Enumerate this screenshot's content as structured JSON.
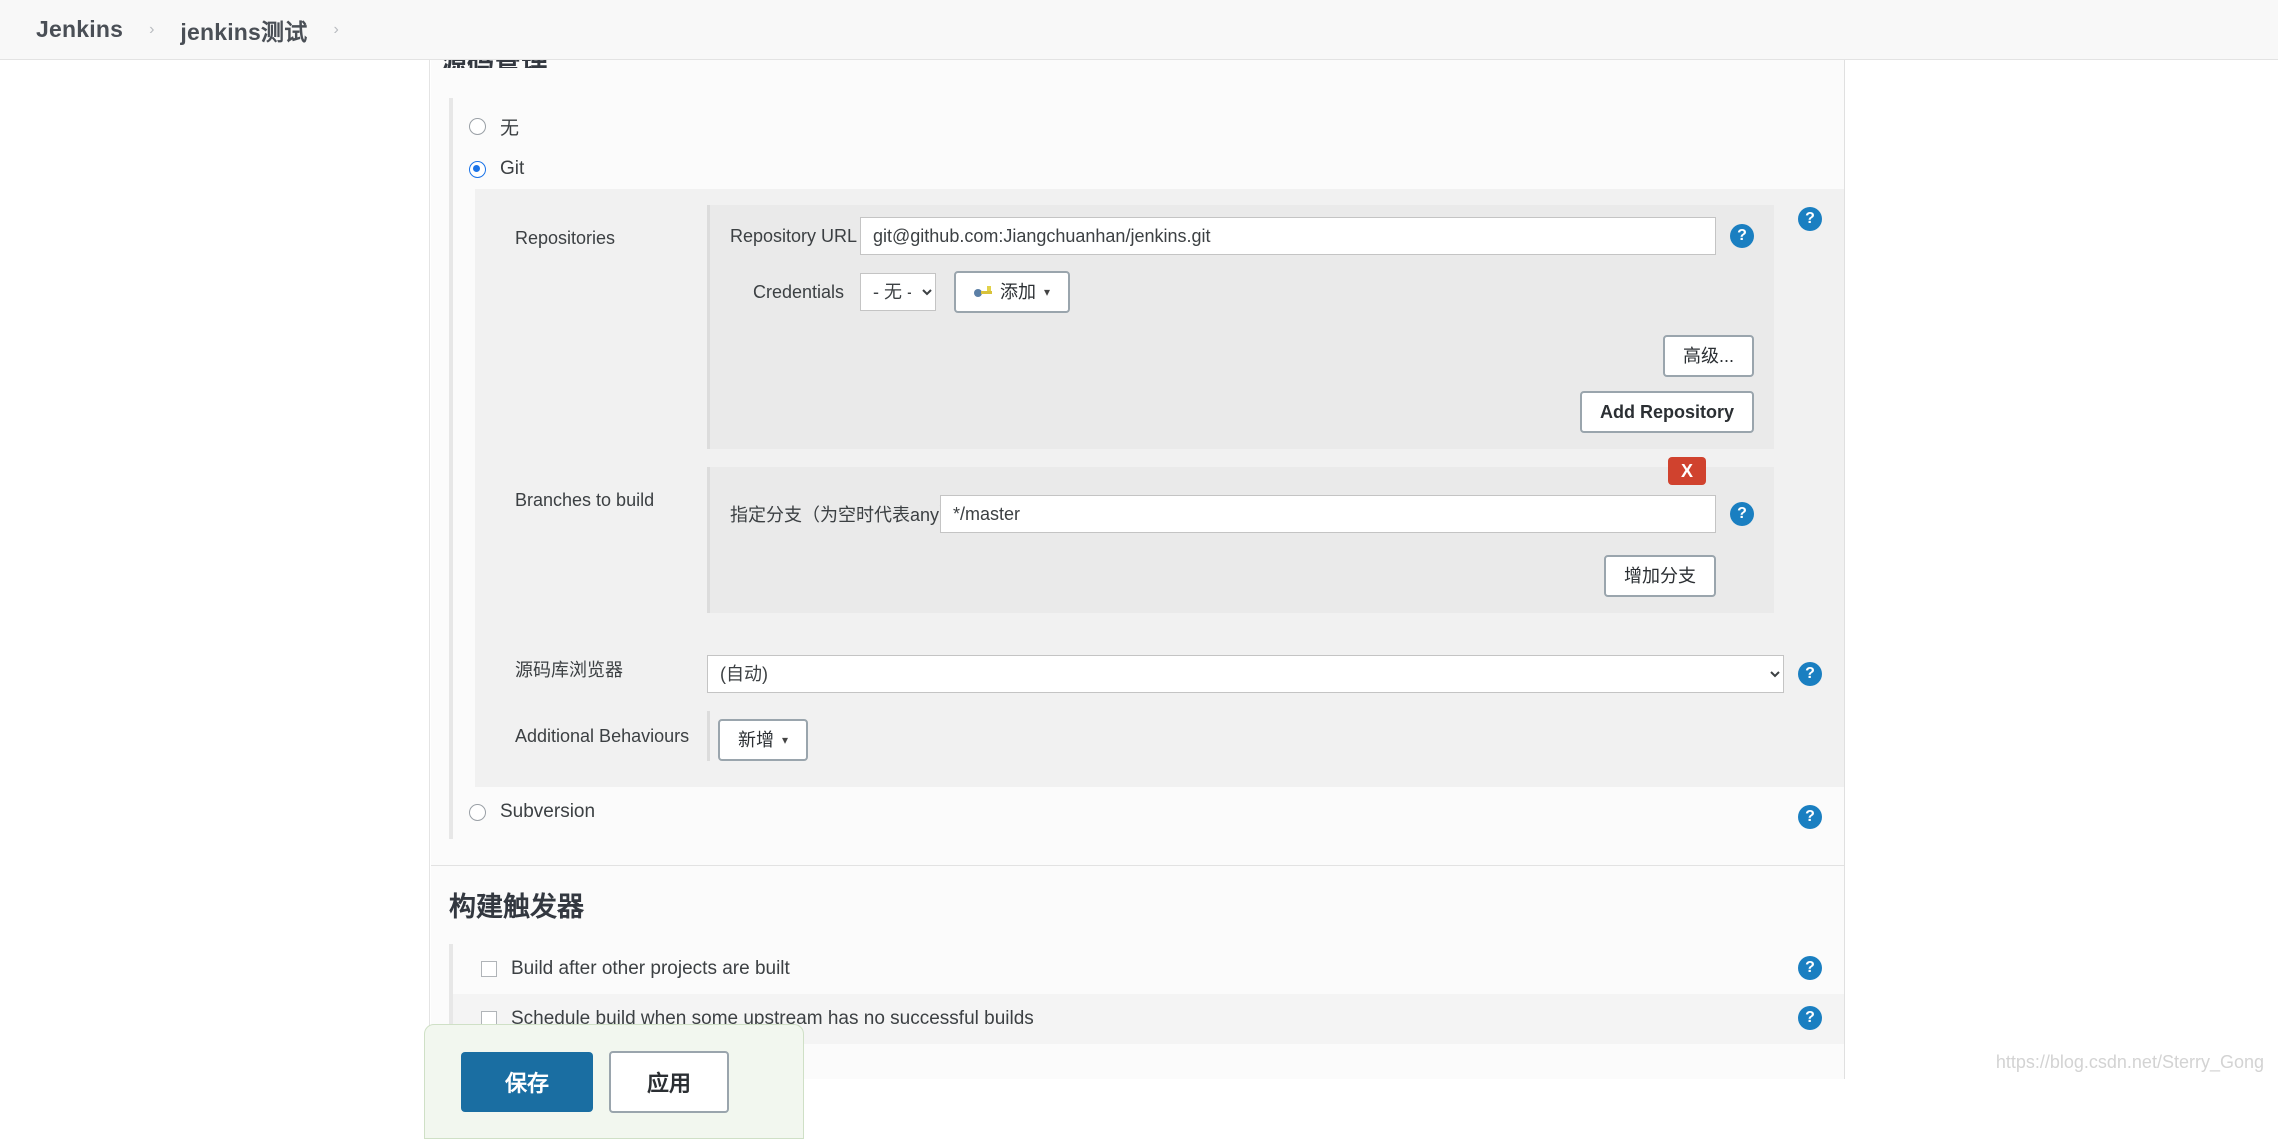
{
  "breadcrumb": {
    "items": [
      {
        "label": "Jenkins"
      },
      {
        "label": "jenkins测试"
      }
    ],
    "separator": "›"
  },
  "scm_section": {
    "heading": "源码管理",
    "options": [
      {
        "label": "无",
        "selected": false
      },
      {
        "label": "Git",
        "selected": true
      },
      {
        "label": "Subversion",
        "selected": false
      }
    ],
    "repositories": {
      "label": "Repositories",
      "repository_url": {
        "caption": "Repository URL",
        "value": "git@github.com:Jiangchuanhan/jenkins.git"
      },
      "credentials": {
        "caption": "Credentials",
        "selected": "- 无 -",
        "options": [
          "- 无 -"
        ],
        "add_button": "添加",
        "add_icon": "key-icon",
        "caret": "▾"
      },
      "advanced_button": "高级...",
      "add_repository_button": "Add Repository"
    },
    "branches": {
      "label": "Branches to build",
      "branch_caption": "指定分支（为空时代表any）",
      "branch_value": "*/master",
      "delete_badge": "X",
      "add_branch_button": "增加分支"
    },
    "repo_browser": {
      "label": "源码库浏览器",
      "selected": "(自动)",
      "options": [
        "(自动)"
      ]
    },
    "additional_behaviours": {
      "label": "Additional Behaviours",
      "add_button": "新增",
      "caret": "▾"
    },
    "help_label": "?"
  },
  "triggers_section": {
    "heading": "构建触发器",
    "items": [
      {
        "label": "Build after other projects are built",
        "checked": false
      },
      {
        "label": "Schedule build when some upstream has no successful builds",
        "checked": false
      }
    ]
  },
  "save_bar": {
    "save_label": "保存",
    "apply_label": "应用"
  },
  "watermark": "https://blog.csdn.net/Sterry_Gong"
}
